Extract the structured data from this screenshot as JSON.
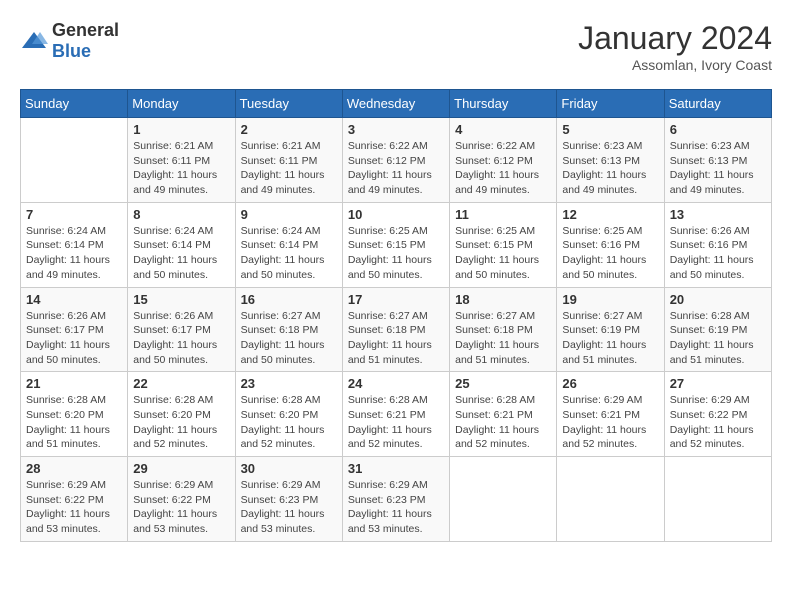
{
  "header": {
    "logo_general": "General",
    "logo_blue": "Blue",
    "month": "January 2024",
    "location": "Assomlan, Ivory Coast"
  },
  "days_of_week": [
    "Sunday",
    "Monday",
    "Tuesday",
    "Wednesday",
    "Thursday",
    "Friday",
    "Saturday"
  ],
  "weeks": [
    [
      {
        "day": "",
        "info": ""
      },
      {
        "day": "1",
        "info": "Sunrise: 6:21 AM\nSunset: 6:11 PM\nDaylight: 11 hours\nand 49 minutes."
      },
      {
        "day": "2",
        "info": "Sunrise: 6:21 AM\nSunset: 6:11 PM\nDaylight: 11 hours\nand 49 minutes."
      },
      {
        "day": "3",
        "info": "Sunrise: 6:22 AM\nSunset: 6:12 PM\nDaylight: 11 hours\nand 49 minutes."
      },
      {
        "day": "4",
        "info": "Sunrise: 6:22 AM\nSunset: 6:12 PM\nDaylight: 11 hours\nand 49 minutes."
      },
      {
        "day": "5",
        "info": "Sunrise: 6:23 AM\nSunset: 6:13 PM\nDaylight: 11 hours\nand 49 minutes."
      },
      {
        "day": "6",
        "info": "Sunrise: 6:23 AM\nSunset: 6:13 PM\nDaylight: 11 hours\nand 49 minutes."
      }
    ],
    [
      {
        "day": "7",
        "info": "Sunrise: 6:24 AM\nSunset: 6:14 PM\nDaylight: 11 hours\nand 49 minutes."
      },
      {
        "day": "8",
        "info": "Sunrise: 6:24 AM\nSunset: 6:14 PM\nDaylight: 11 hours\nand 50 minutes."
      },
      {
        "day": "9",
        "info": "Sunrise: 6:24 AM\nSunset: 6:14 PM\nDaylight: 11 hours\nand 50 minutes."
      },
      {
        "day": "10",
        "info": "Sunrise: 6:25 AM\nSunset: 6:15 PM\nDaylight: 11 hours\nand 50 minutes."
      },
      {
        "day": "11",
        "info": "Sunrise: 6:25 AM\nSunset: 6:15 PM\nDaylight: 11 hours\nand 50 minutes."
      },
      {
        "day": "12",
        "info": "Sunrise: 6:25 AM\nSunset: 6:16 PM\nDaylight: 11 hours\nand 50 minutes."
      },
      {
        "day": "13",
        "info": "Sunrise: 6:26 AM\nSunset: 6:16 PM\nDaylight: 11 hours\nand 50 minutes."
      }
    ],
    [
      {
        "day": "14",
        "info": "Sunrise: 6:26 AM\nSunset: 6:17 PM\nDaylight: 11 hours\nand 50 minutes."
      },
      {
        "day": "15",
        "info": "Sunrise: 6:26 AM\nSunset: 6:17 PM\nDaylight: 11 hours\nand 50 minutes."
      },
      {
        "day": "16",
        "info": "Sunrise: 6:27 AM\nSunset: 6:18 PM\nDaylight: 11 hours\nand 50 minutes."
      },
      {
        "day": "17",
        "info": "Sunrise: 6:27 AM\nSunset: 6:18 PM\nDaylight: 11 hours\nand 51 minutes."
      },
      {
        "day": "18",
        "info": "Sunrise: 6:27 AM\nSunset: 6:18 PM\nDaylight: 11 hours\nand 51 minutes."
      },
      {
        "day": "19",
        "info": "Sunrise: 6:27 AM\nSunset: 6:19 PM\nDaylight: 11 hours\nand 51 minutes."
      },
      {
        "day": "20",
        "info": "Sunrise: 6:28 AM\nSunset: 6:19 PM\nDaylight: 11 hours\nand 51 minutes."
      }
    ],
    [
      {
        "day": "21",
        "info": "Sunrise: 6:28 AM\nSunset: 6:20 PM\nDaylight: 11 hours\nand 51 minutes."
      },
      {
        "day": "22",
        "info": "Sunrise: 6:28 AM\nSunset: 6:20 PM\nDaylight: 11 hours\nand 52 minutes."
      },
      {
        "day": "23",
        "info": "Sunrise: 6:28 AM\nSunset: 6:20 PM\nDaylight: 11 hours\nand 52 minutes."
      },
      {
        "day": "24",
        "info": "Sunrise: 6:28 AM\nSunset: 6:21 PM\nDaylight: 11 hours\nand 52 minutes."
      },
      {
        "day": "25",
        "info": "Sunrise: 6:28 AM\nSunset: 6:21 PM\nDaylight: 11 hours\nand 52 minutes."
      },
      {
        "day": "26",
        "info": "Sunrise: 6:29 AM\nSunset: 6:21 PM\nDaylight: 11 hours\nand 52 minutes."
      },
      {
        "day": "27",
        "info": "Sunrise: 6:29 AM\nSunset: 6:22 PM\nDaylight: 11 hours\nand 52 minutes."
      }
    ],
    [
      {
        "day": "28",
        "info": "Sunrise: 6:29 AM\nSunset: 6:22 PM\nDaylight: 11 hours\nand 53 minutes."
      },
      {
        "day": "29",
        "info": "Sunrise: 6:29 AM\nSunset: 6:22 PM\nDaylight: 11 hours\nand 53 minutes."
      },
      {
        "day": "30",
        "info": "Sunrise: 6:29 AM\nSunset: 6:23 PM\nDaylight: 11 hours\nand 53 minutes."
      },
      {
        "day": "31",
        "info": "Sunrise: 6:29 AM\nSunset: 6:23 PM\nDaylight: 11 hours\nand 53 minutes."
      },
      {
        "day": "",
        "info": ""
      },
      {
        "day": "",
        "info": ""
      },
      {
        "day": "",
        "info": ""
      }
    ]
  ]
}
